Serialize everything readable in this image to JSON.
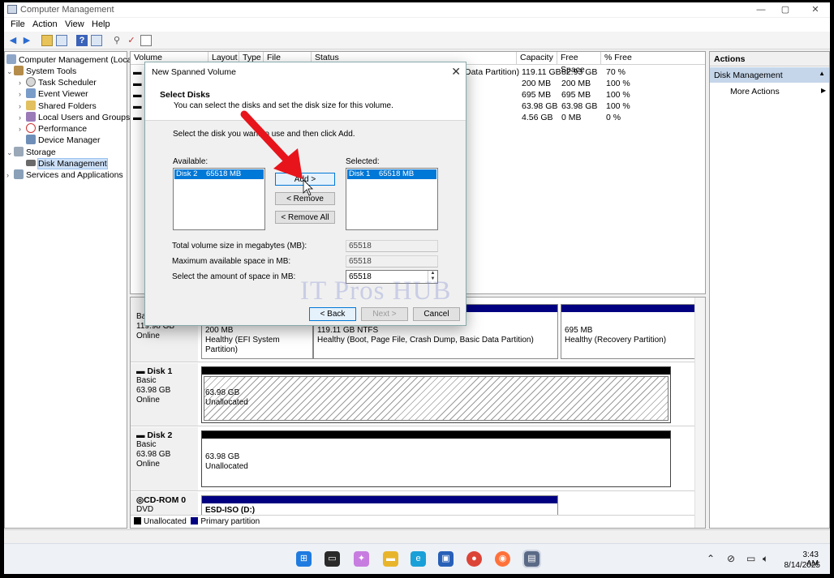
{
  "window": {
    "title": "Computer Management",
    "minimize": "—",
    "maximize": "▢",
    "close": "✕"
  },
  "menu": [
    "File",
    "Action",
    "View",
    "Help"
  ],
  "tree": {
    "root": "Computer Management (Local)",
    "system_tools": "System Tools",
    "task_scheduler": "Task Scheduler",
    "event_viewer": "Event Viewer",
    "shared_folders": "Shared Folders",
    "local_users": "Local Users and Groups",
    "performance": "Performance",
    "device_manager": "Device Manager",
    "storage": "Storage",
    "disk_management": "Disk Management",
    "services": "Services and Applications"
  },
  "volume_list": {
    "columns": [
      "Volume",
      "Layout",
      "Type",
      "File System",
      "Status",
      "Capacity",
      "Free Space",
      "% Free"
    ],
    "rows": [
      {
        "status": "Data Partition)",
        "capacity": "119.11 GB",
        "free": "82.93 GB",
        "pct": "70 %"
      },
      {
        "status": "",
        "capacity": "200 MB",
        "free": "200 MB",
        "pct": "100 %"
      },
      {
        "status": "",
        "capacity": "695 MB",
        "free": "695 MB",
        "pct": "100 %"
      },
      {
        "status": "",
        "capacity": "63.98 GB",
        "free": "63.98 GB",
        "pct": "100 %"
      },
      {
        "status": "",
        "capacity": "4.56 GB",
        "free": "0 MB",
        "pct": "0 %"
      }
    ]
  },
  "disks": {
    "disk0": {
      "name": "Bas",
      "size": "119.98 GB",
      "state": "Online",
      "p1_size": "200 MB",
      "p1_status": "Healthy (EFI System Partition)",
      "p2_size": "119.11 GB NTFS",
      "p2_status": "Healthy (Boot, Page File, Crash Dump, Basic Data Partition)",
      "p3_size": "695 MB",
      "p3_status": "Healthy (Recovery Partition)"
    },
    "disk1": {
      "name": "Disk 1",
      "type": "Basic",
      "size": "63.98 GB",
      "state": "Online",
      "part_size": "63.98 GB",
      "part_status": "Unallocated"
    },
    "disk2": {
      "name": "Disk 2",
      "type": "Basic",
      "size": "63.98 GB",
      "state": "Online",
      "part_size": "63.98 GB",
      "part_status": "Unallocated"
    },
    "cdrom": {
      "name": "CD-ROM 0",
      "type": "DVD",
      "volume": "ESD-ISO  (D:)"
    }
  },
  "legend": {
    "unallocated": "Unallocated",
    "primary": "Primary partition"
  },
  "actions": {
    "header": "Actions",
    "section": "Disk Management",
    "more": "More Actions"
  },
  "dialog": {
    "title": "New Spanned Volume",
    "heading": "Select Disks",
    "subheading": "You can select the disks and set the disk size for this volume.",
    "instruction": "Select the disk you want to use and then click Add.",
    "available_label": "Available:",
    "available_item": "Disk 2    65518 MB",
    "selected_label": "Selected:",
    "selected_item": "Disk 1    65518 MB",
    "add": "Add >",
    "remove": "< Remove",
    "remove_all": "< Remove All",
    "total_label": "Total volume size in megabytes (MB):",
    "total_value": "65518",
    "max_label": "Maximum available space in MB:",
    "max_value": "65518",
    "amount_label": "Select the amount of space in MB:",
    "amount_value": "65518",
    "back": "< Back",
    "next": "Next >",
    "cancel": "Cancel"
  },
  "watermark": "IT Pros HUB",
  "clock": {
    "time": "3:43 AM",
    "date": "8/14/2025"
  },
  "colors": {
    "primary_partition": "#000080",
    "selection": "#0078d7",
    "arrow": "#e8141b"
  }
}
